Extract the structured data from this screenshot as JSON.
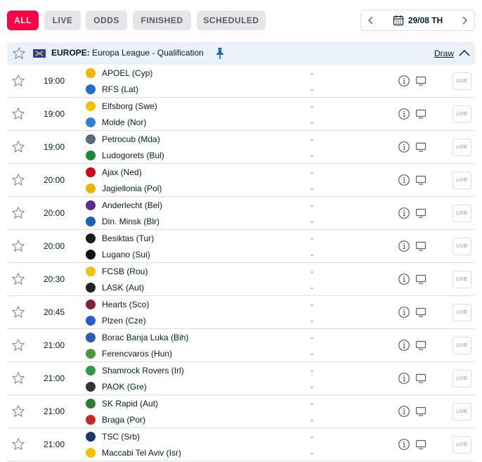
{
  "filters": [
    {
      "label": "ALL",
      "active": true
    },
    {
      "label": "LIVE",
      "active": false
    },
    {
      "label": "ODDS",
      "active": false
    },
    {
      "label": "FINISHED",
      "active": false
    },
    {
      "label": "SCHEDULED",
      "active": false
    }
  ],
  "date_picker": {
    "date_label": "29/08 TH",
    "prev_icon": "chevron-left-icon",
    "next_icon": "chevron-right-icon",
    "calendar_icon": "calendar-icon"
  },
  "league": {
    "country": "EUROPE:",
    "name": "Europa League - Qualification",
    "draw_link": "Draw",
    "flag_color": "#2a3f9d",
    "pin_color": "#0b6bd3"
  },
  "colors": {
    "accent": "#ff0046",
    "header_bg": "#eaf1f9",
    "text": "#001e28",
    "muted": "#555e61",
    "border": "#dcdde1"
  },
  "live_label": "LIVE",
  "matches": [
    {
      "time": "19:00",
      "home": "APOEL (Cyp)",
      "away": "RFS (Lat)",
      "home_score": "-",
      "away_score": "-",
      "home_color": "#f4b400",
      "away_color": "#1f6fd1"
    },
    {
      "time": "19:00",
      "home": "Elfsborg (Swe)",
      "away": "Molde (Nor)",
      "home_score": "-",
      "away_score": "-",
      "home_color": "#f2c200",
      "away_color": "#2f7fd6"
    },
    {
      "time": "19:00",
      "home": "Petrocub (Mda)",
      "away": "Ludogorets (Bul)",
      "home_score": "-",
      "away_score": "-",
      "home_color": "#5b6b7a",
      "away_color": "#1d8a3a"
    },
    {
      "time": "20:00",
      "home": "Ajax (Ned)",
      "away": "Jagiellonia (Pol)",
      "home_score": "-",
      "away_score": "-",
      "home_color": "#d0021b",
      "away_color": "#e8b400"
    },
    {
      "time": "20:00",
      "home": "Anderlecht (Bel)",
      "away": "Din. Minsk (Blr)",
      "home_score": "-",
      "away_score": "-",
      "home_color": "#5b2d8e",
      "away_color": "#1a5fb4"
    },
    {
      "time": "20:00",
      "home": "Besiktas (Tur)",
      "away": "Lugano (Sui)",
      "home_score": "-",
      "away_score": "-",
      "home_color": "#1a1a1a",
      "away_color": "#111111"
    },
    {
      "time": "20:30",
      "home": "FCSB (Rou)",
      "away": "LASK (Aut)",
      "home_score": "-",
      "away_score": "-",
      "home_color": "#f4c20d",
      "away_color": "#222222"
    },
    {
      "time": "20:45",
      "home": "Hearts (Sco)",
      "away": "Plzen (Cze)",
      "home_score": "-",
      "away_score": "-",
      "home_color": "#8c1d3d",
      "away_color": "#2a5bd7"
    },
    {
      "time": "21:00",
      "home": "Borac Banja Luka (Bih)",
      "away": "Ferencvaros (Hun)",
      "home_score": "-",
      "away_score": "-",
      "home_color": "#2b5cb8",
      "away_color": "#4a9b3d"
    },
    {
      "time": "21:00",
      "home": "Shamrock Rovers (Irl)",
      "away": "PAOK (Gre)",
      "home_score": "-",
      "away_score": "-",
      "home_color": "#2e9a4a",
      "away_color": "#333333"
    },
    {
      "time": "21:00",
      "home": "SK Rapid (Aut)",
      "away": "Braga (Por)",
      "home_score": "-",
      "away_score": "-",
      "home_color": "#2e7d32",
      "away_color": "#c62828"
    },
    {
      "time": "21:00",
      "home": "TSC (Srb)",
      "away": "Maccabi Tel Aviv (Isr)",
      "home_score": "-",
      "away_score": "-",
      "home_color": "#1f3a6e",
      "away_color": "#f2c200"
    }
  ]
}
